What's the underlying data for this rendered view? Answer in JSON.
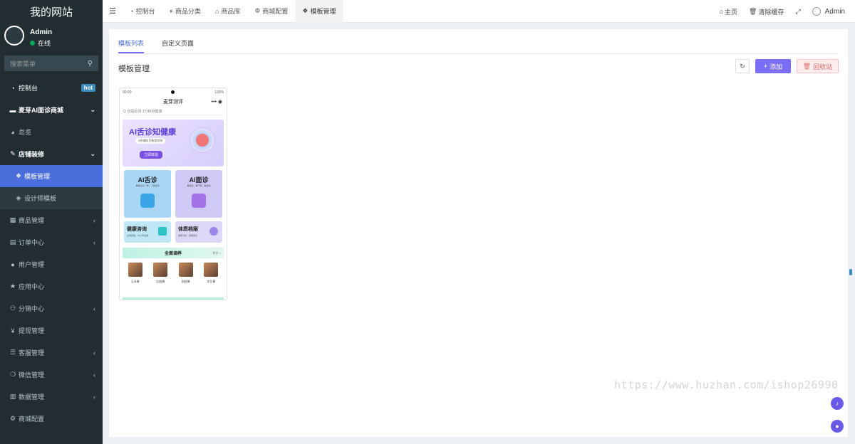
{
  "sidebar": {
    "brand": "我的网站",
    "user": {
      "name": "Admin",
      "status": "在线"
    },
    "search_placeholder": "搜索菜单",
    "items": [
      {
        "label": "控制台",
        "icon": "dashboard-icon",
        "badge": "hot"
      },
      {
        "label": "麦芽AI面诊商城",
        "icon": "briefcase-icon",
        "caret": "⌄"
      },
      {
        "label": "总览",
        "icon": "pie-chart-icon"
      },
      {
        "label": "店铺装修",
        "icon": "paintbrush-icon",
        "caret": "⌄"
      },
      {
        "label": "模板管理",
        "icon": "cubes-icon"
      },
      {
        "label": "设计师模板",
        "icon": "cube-icon"
      },
      {
        "label": "商品管理",
        "icon": "grid-icon",
        "caret": "‹"
      },
      {
        "label": "订单中心",
        "icon": "file-icon",
        "caret": "‹"
      },
      {
        "label": "用户管理",
        "icon": "user-icon"
      },
      {
        "label": "应用中心",
        "icon": "star-icon"
      },
      {
        "label": "分销中心",
        "icon": "users-icon",
        "caret": "‹"
      },
      {
        "label": "提现管理",
        "icon": "yen-icon"
      },
      {
        "label": "客服管理",
        "icon": "list-icon",
        "caret": "‹"
      },
      {
        "label": "微信管理",
        "icon": "wechat-icon",
        "caret": "‹"
      },
      {
        "label": "数据管理",
        "icon": "bar-chart-icon",
        "caret": "‹"
      },
      {
        "label": "商城配置",
        "icon": "gears-icon"
      }
    ]
  },
  "header": {
    "tabs": [
      {
        "label": "控制台",
        "icon": "dashboard-icon"
      },
      {
        "label": "商品分类",
        "icon": "sitemap-icon"
      },
      {
        "label": "商品库",
        "icon": "bank-icon"
      },
      {
        "label": "商城配置",
        "icon": "gears-icon"
      },
      {
        "label": "模板管理",
        "icon": "cubes-icon"
      }
    ],
    "home_label": "主页",
    "clear_cache_label": "清除缓存",
    "user_name": "Admin"
  },
  "content": {
    "subtabs": [
      "模板列表",
      "自定义页面"
    ],
    "title": "模板管理",
    "add_label": "添加",
    "recycle_label": "回收站"
  },
  "preview": {
    "status_time": "00:00",
    "status_right": "100%",
    "title": "麦芽测评",
    "search_hint": "Q 自拍检测 3分钟测健康",
    "banner_title": "AI舌诊知健康",
    "banner_sub": "3秒辅助舌象提前知",
    "banner_button": "立即体验",
    "tile1_title": "AI舌诊",
    "tile1_sub": "看看舌头一伸，一键检测",
    "tile2_title": "AI面诊",
    "tile2_sub": "看面色，看气色，看健康",
    "small1_title": "健康咨询",
    "small1_sub": "在线咨询，24小时在线",
    "small2_title": "体质档案",
    "small2_sub": "体质分析，健康建议",
    "section_title": "全面调养",
    "section_more": "更多 >",
    "products": [
      "王灵膏",
      "红曲膏",
      "固经膏",
      "岁艾膏"
    ]
  },
  "watermark": "https://www.huzhan.com/ishop26990"
}
